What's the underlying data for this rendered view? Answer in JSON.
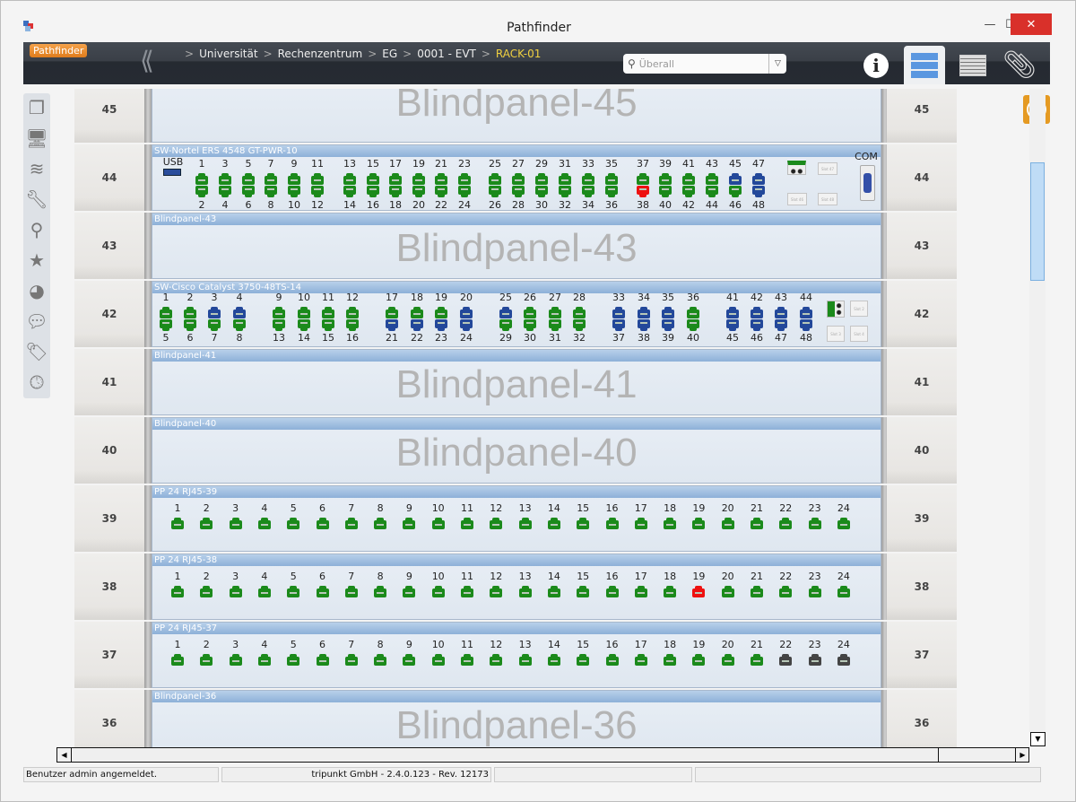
{
  "window": {
    "title": "Pathfinder",
    "minimize": "—",
    "maximize": "☐",
    "close": "✕"
  },
  "toolbar": {
    "brand": "Pathfinder",
    "breadcrumbs": [
      "Universität",
      "Rechenzentrum",
      "EG",
      "0001 - EVT"
    ],
    "current": "RACK-01",
    "search_placeholder": "Überall",
    "buttons": [
      "info-icon",
      "rack-view-icon",
      "list-view-icon",
      "paperclip-icon"
    ]
  },
  "sidebar": {
    "icons": [
      "objects-icon",
      "computer-icon",
      "layers-icon",
      "tools-icon",
      "search-icon",
      "star-icon",
      "chart-icon",
      "chat-icon",
      "tag-icon",
      "clock-icon"
    ]
  },
  "port_colors": {
    "g": "#1b8a1b",
    "b": "#23489a",
    "r": "#ee1111",
    "k": "#444444"
  },
  "rack": [
    {
      "unit": "45",
      "type": "blind",
      "label": "",
      "big": "Blindpanel-45"
    },
    {
      "unit": "44",
      "type": "switch",
      "label": "SW-Nortel ERS 4548 GT-PWR-10",
      "usb": "USB",
      "com": "COM",
      "slots": [
        "Slot 47",
        "Slot 46",
        "Slot 48"
      ],
      "top": [
        1,
        3,
        5,
        7,
        9,
        11,
        13,
        15,
        17,
        19,
        21,
        23,
        25,
        27,
        29,
        31,
        33,
        35,
        37,
        39,
        41,
        43,
        45,
        47
      ],
      "bottom": [
        2,
        4,
        6,
        8,
        10,
        12,
        14,
        16,
        18,
        20,
        22,
        24,
        26,
        28,
        30,
        32,
        34,
        36,
        38,
        40,
        42,
        44,
        46,
        48
      ],
      "top_status": "ggggggggggggggggggggggbb",
      "bottom_status": "ggggggggggggggggggrggggb"
    },
    {
      "unit": "43",
      "type": "blind",
      "label": "Blindpanel-43",
      "big": "Blindpanel-43"
    },
    {
      "unit": "42",
      "type": "switch",
      "label": "SW-Cisco Catalyst 3750-48TS-14",
      "slots": [
        "Slot 2",
        "Slot 3",
        "Slot 4"
      ],
      "top": [
        1,
        2,
        3,
        4,
        9,
        10,
        11,
        12,
        17,
        18,
        19,
        20,
        25,
        26,
        27,
        28,
        33,
        34,
        35,
        36,
        41,
        42,
        43,
        44
      ],
      "bottom": [
        5,
        6,
        7,
        8,
        13,
        14,
        15,
        16,
        21,
        22,
        23,
        24,
        29,
        30,
        31,
        32,
        37,
        38,
        39,
        40,
        45,
        46,
        47,
        48
      ],
      "top_status": "ggbbgggggggbbgggbbbgbbbb",
      "bottom_status": "ggggggggbbbbggggbbbgbbbb"
    },
    {
      "unit": "41",
      "type": "blind",
      "label": "Blindpanel-41",
      "big": "Blindpanel-41"
    },
    {
      "unit": "40",
      "type": "blind",
      "label": "Blindpanel-40",
      "big": "Blindpanel-40"
    },
    {
      "unit": "39",
      "type": "patch",
      "label": "PP 24 RJ45-39",
      "status": "gggggggggggggggggggggggg"
    },
    {
      "unit": "38",
      "type": "patch",
      "label": "PP 24 RJ45-38",
      "status": "ggggggggggggggggggrggggg"
    },
    {
      "unit": "37",
      "type": "patch",
      "label": "PP 24 RJ45-37",
      "status": "gggggggggggggggggggggkkk"
    },
    {
      "unit": "36",
      "type": "blind",
      "label": "Blindpanel-36",
      "big": "Blindpanel-36"
    }
  ],
  "statusbar": [
    "Benutzer admin angemeldet.",
    "tripunkt GmbH - 2.4.0.123 - Rev. 12173",
    "",
    ""
  ]
}
